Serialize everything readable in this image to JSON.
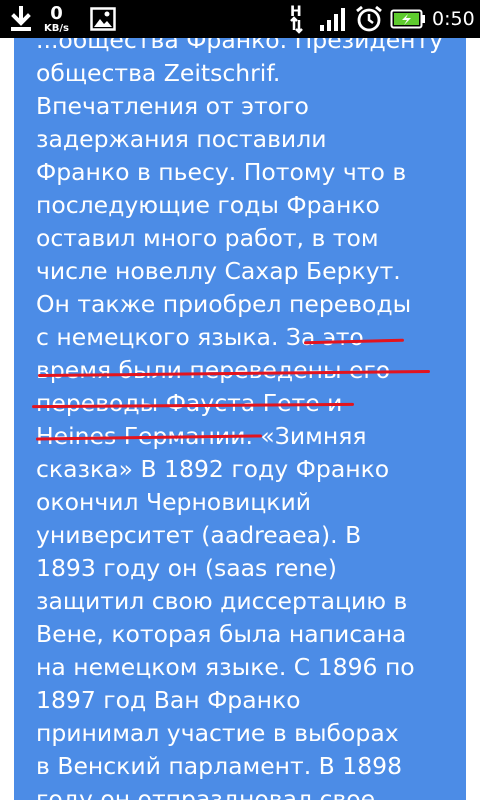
{
  "status_bar": {
    "download_icon": "download-arrow-icon",
    "speed_value": "0",
    "speed_unit": "KB/s",
    "image_icon": "image-notification-icon",
    "network_type": "H",
    "signal_icon": "signal-strength-icon",
    "alarm_icon": "alarm-clock-icon",
    "battery_icon": "battery-charging-icon",
    "time": "0:50"
  },
  "colors": {
    "status_bar_bg": "#000000",
    "content_bg": "#4c8ce6",
    "text": "#ffffff",
    "highlight_underline": "#e3141e",
    "battery_fill": "#5ecb2e"
  },
  "article": {
    "lines": [
      "...общества Франко. Президенту",
      "общества Zeitschrif.",
      "Впечатления от этого",
      "задержания поставили",
      "Франко в пьесу. Потому что в",
      "последующие годы Франко",
      "оставил много работ, в том",
      "числе новеллу Сахар Беркут.",
      "Он также приобрел переводы",
      "с немецкого языка. За это",
      "время были переведены его",
      "переводы Фауста Гете и",
      "Heines Германии. «Зимняя",
      "сказка» В 1892 году Франко",
      "окончил Черновицкий",
      "университет (aadreaea). В",
      "1893 году он (saas rene)",
      "защитил свою диссертацию в",
      "Вене, которая была написана",
      "на немецком языке. С 1896 по",
      "1897 год Ван Франко",
      "принимал участие в выборах",
      "в Венский парламент. В 1898",
      "году он отпраздновал свое"
    ]
  }
}
